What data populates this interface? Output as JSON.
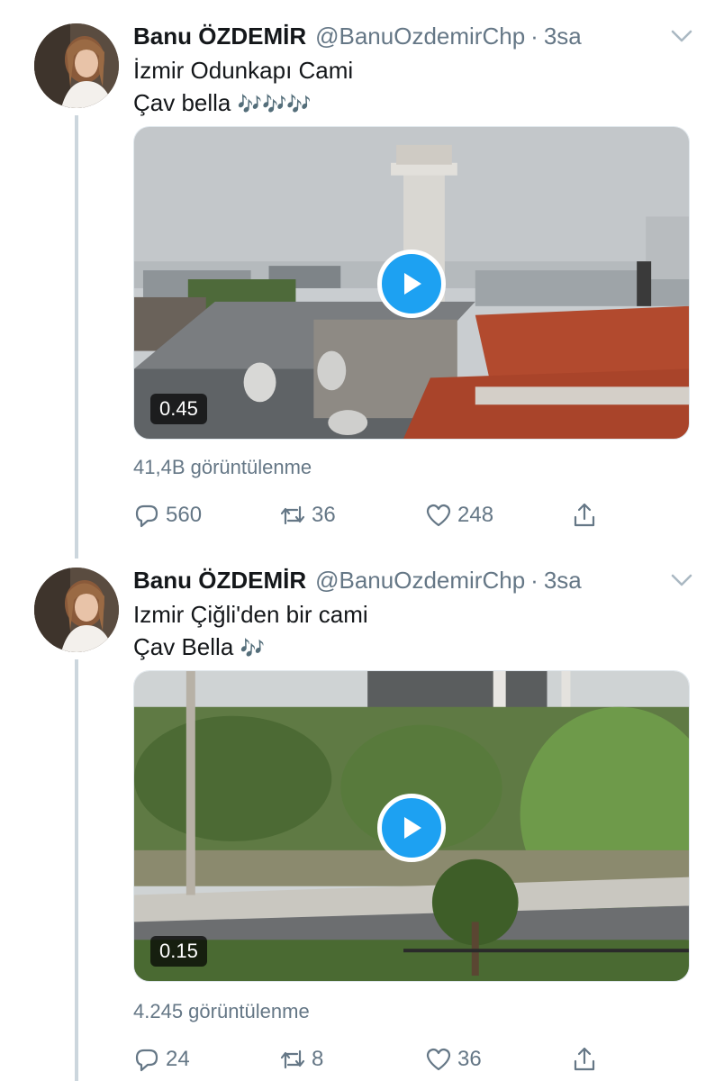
{
  "tweets": [
    {
      "author_name": "Banu ÖZDEMİR",
      "handle": "@BanuOzdemirChp",
      "separator": "·",
      "time": "3sa",
      "lines": [
        "İzmir Odunkapı Cami",
        "Çav bella"
      ],
      "note_emoji": "🎶🎶🎶",
      "video_duration": "0.45",
      "views": "41,4B görüntülenme",
      "reply_count": "560",
      "retweet_count": "36",
      "like_count": "248"
    },
    {
      "author_name": "Banu ÖZDEMİR",
      "handle": "@BanuOzdemirChp",
      "separator": "·",
      "time": "3sa",
      "lines": [
        "Izmir Çiğli'den bir cami",
        "Çav Bella"
      ],
      "note_emoji": "🎶",
      "video_duration": "0.15",
      "views": "4.245 görüntülenme",
      "reply_count": "24",
      "retweet_count": "8",
      "like_count": "36"
    }
  ],
  "icons": {
    "reply": "reply-icon",
    "retweet": "retweet-icon",
    "like": "heart-icon",
    "share": "share-icon",
    "caret": "chevron-down-icon",
    "play": "play-icon"
  },
  "colors": {
    "accent": "#1da1f2",
    "secondary_text": "#657786",
    "thread_line": "#ccd6dd"
  }
}
